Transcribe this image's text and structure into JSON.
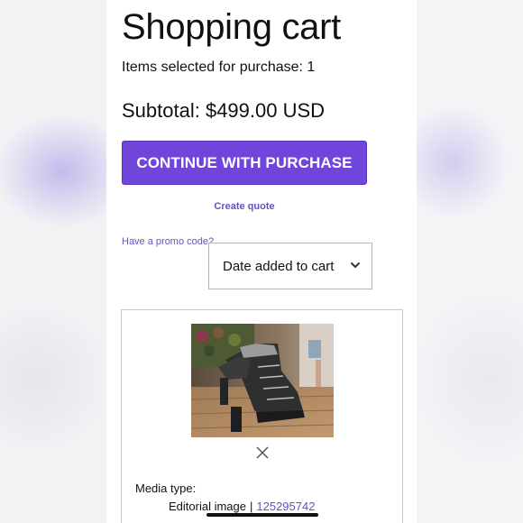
{
  "page": {
    "title": "Shopping cart",
    "items_selected": "Items selected for purchase: 1",
    "subtotal": "Subtotal: $499.00 USD"
  },
  "actions": {
    "continue_label": "CONTINUE WITH PURCHASE",
    "create_quote_label": "Create quote",
    "promo_label": "Have a promo code?"
  },
  "sort": {
    "selected": "Date added to cart"
  },
  "cart_item": {
    "image_icon": "black-lace-up-ankle-boot-photo",
    "remove_icon": "close-icon",
    "media_type_label": "Media type:",
    "media_type_value": "Editorial image",
    "separator": "|",
    "media_id": "125295742"
  },
  "colors": {
    "accent": "#6f45dc",
    "link": "#6a4dc4"
  }
}
